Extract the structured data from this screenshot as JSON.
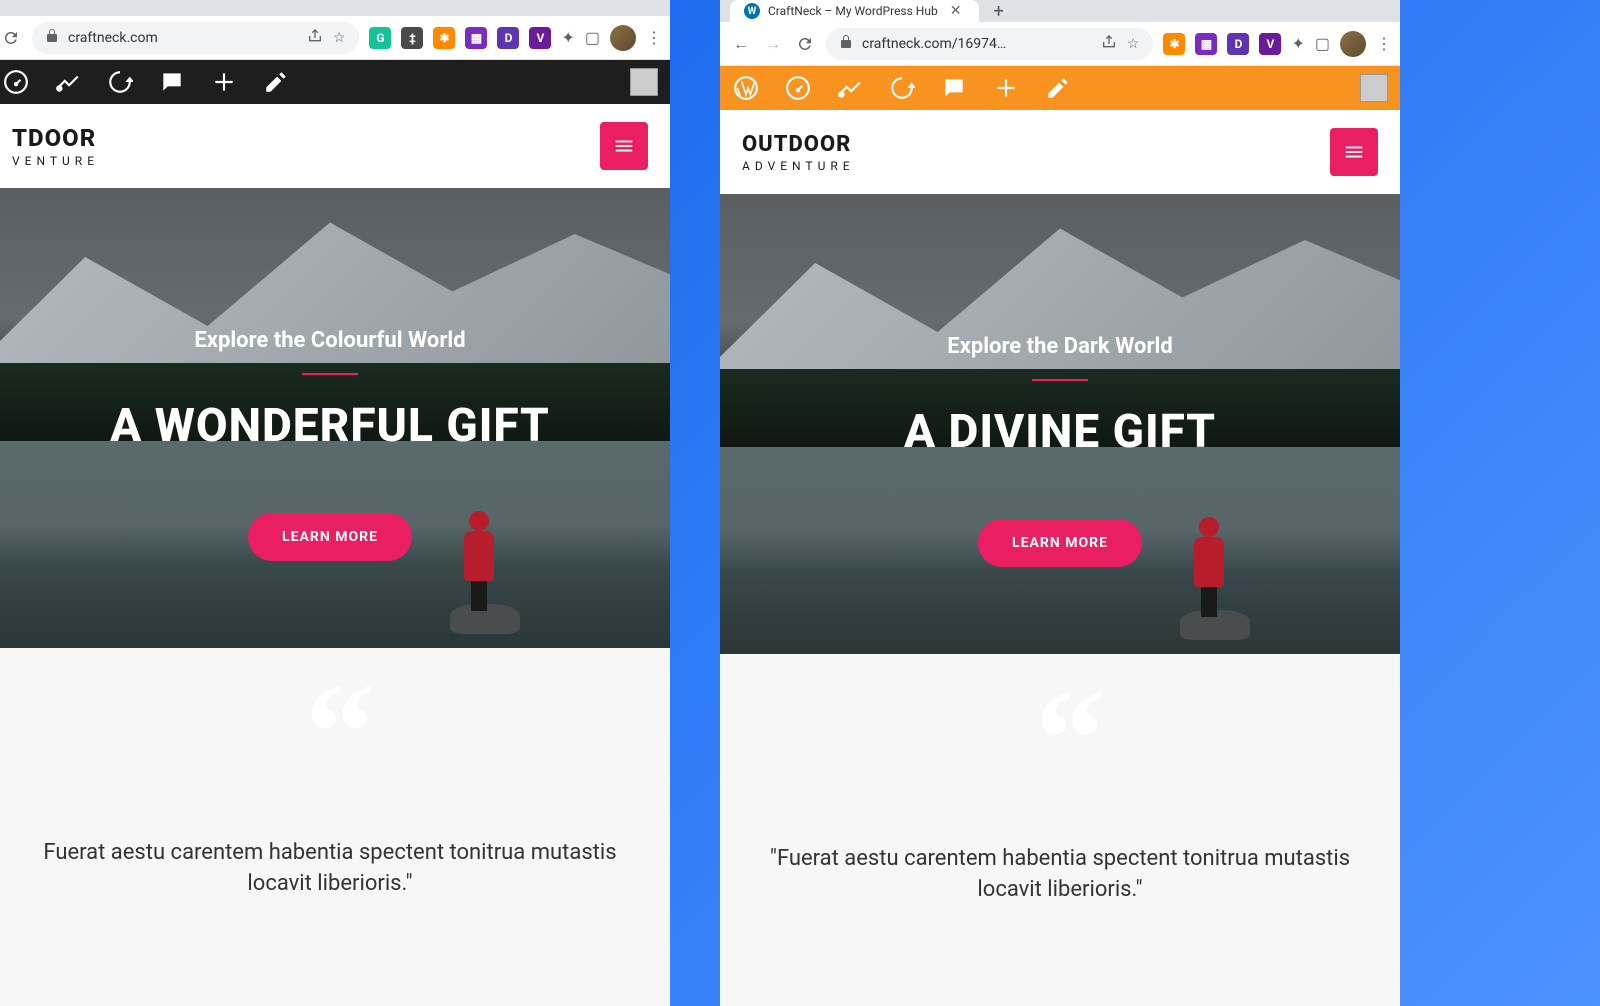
{
  "left": {
    "url": "craftneck.com",
    "adminbar_color": "dark",
    "logo_top": "TDOOR",
    "logo_bot": "VENTURE",
    "hero_sub": "Explore the Colourful World",
    "hero_title": "A WONDERFUL GIFT",
    "hero_btn": "LEARN MORE",
    "quote": "Fuerat aestu carentem habentia spectent tonitrua mutastis locavit liberioris.\""
  },
  "right": {
    "tab_title": "CraftNeck – My WordPress Hub",
    "url": "craftneck.com/16974…",
    "adminbar_color": "orange",
    "logo_top": "OUTDOOR",
    "logo_bot": "ADVENTURE",
    "hero_sub": "Explore the Dark World",
    "hero_title": "A DIVINE GIFT",
    "hero_btn": "LEARN MORE",
    "quote": "\"Fuerat aestu carentem habentia spectent tonitrua mutastis locavit liberioris.\""
  },
  "ext": {
    "grammarly": "G",
    "d_purple": "D",
    "brave": "V"
  }
}
